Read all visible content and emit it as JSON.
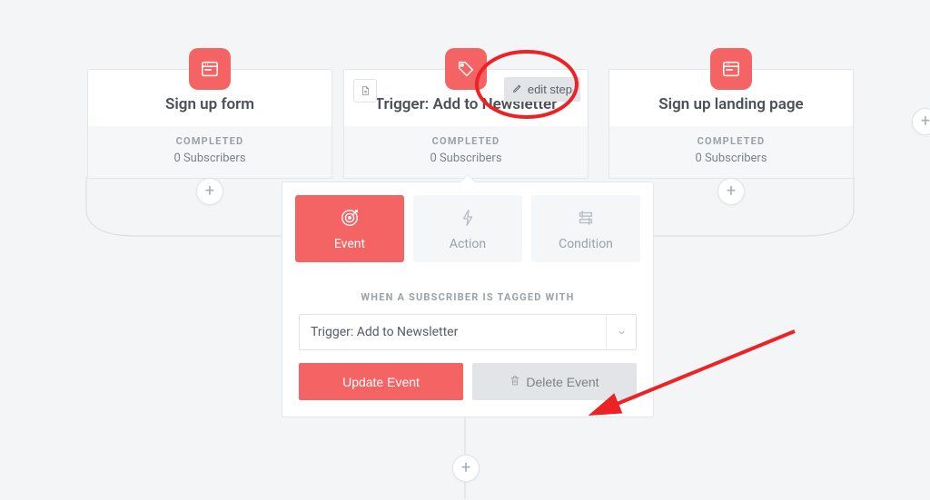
{
  "colors": {
    "accent": "#f46464"
  },
  "cards": {
    "left": {
      "title": "Sign up form",
      "status": "COMPLETED",
      "subs": "0 Subscribers"
    },
    "center": {
      "title": "Trigger: Add to Newsletter",
      "status": "COMPLETED",
      "subs": "0 Subscribers",
      "edit_step": "edit step"
    },
    "right": {
      "title": "Sign up landing page",
      "status": "COMPLETED",
      "subs": "0 Subscribers"
    }
  },
  "icons": {
    "page": "page-icon",
    "tag": "tag-icon",
    "file": "file-icon",
    "pencil": "pencil-icon",
    "target": "target-icon",
    "bolt": "bolt-icon",
    "condition": "condition-icon",
    "trash": "trash-icon",
    "plus": "plus-icon",
    "chevronDown": "chevron-down-icon"
  },
  "panel": {
    "tabs": [
      {
        "label": "Event"
      },
      {
        "label": "Action"
      },
      {
        "label": "Condition"
      }
    ],
    "sectionLabel": "WHEN A SUBSCRIBER IS TAGGED WITH",
    "selectValue": "Trigger: Add to Newsletter",
    "primaryBtn": "Update Event",
    "secondaryBtn": "Delete Event"
  }
}
